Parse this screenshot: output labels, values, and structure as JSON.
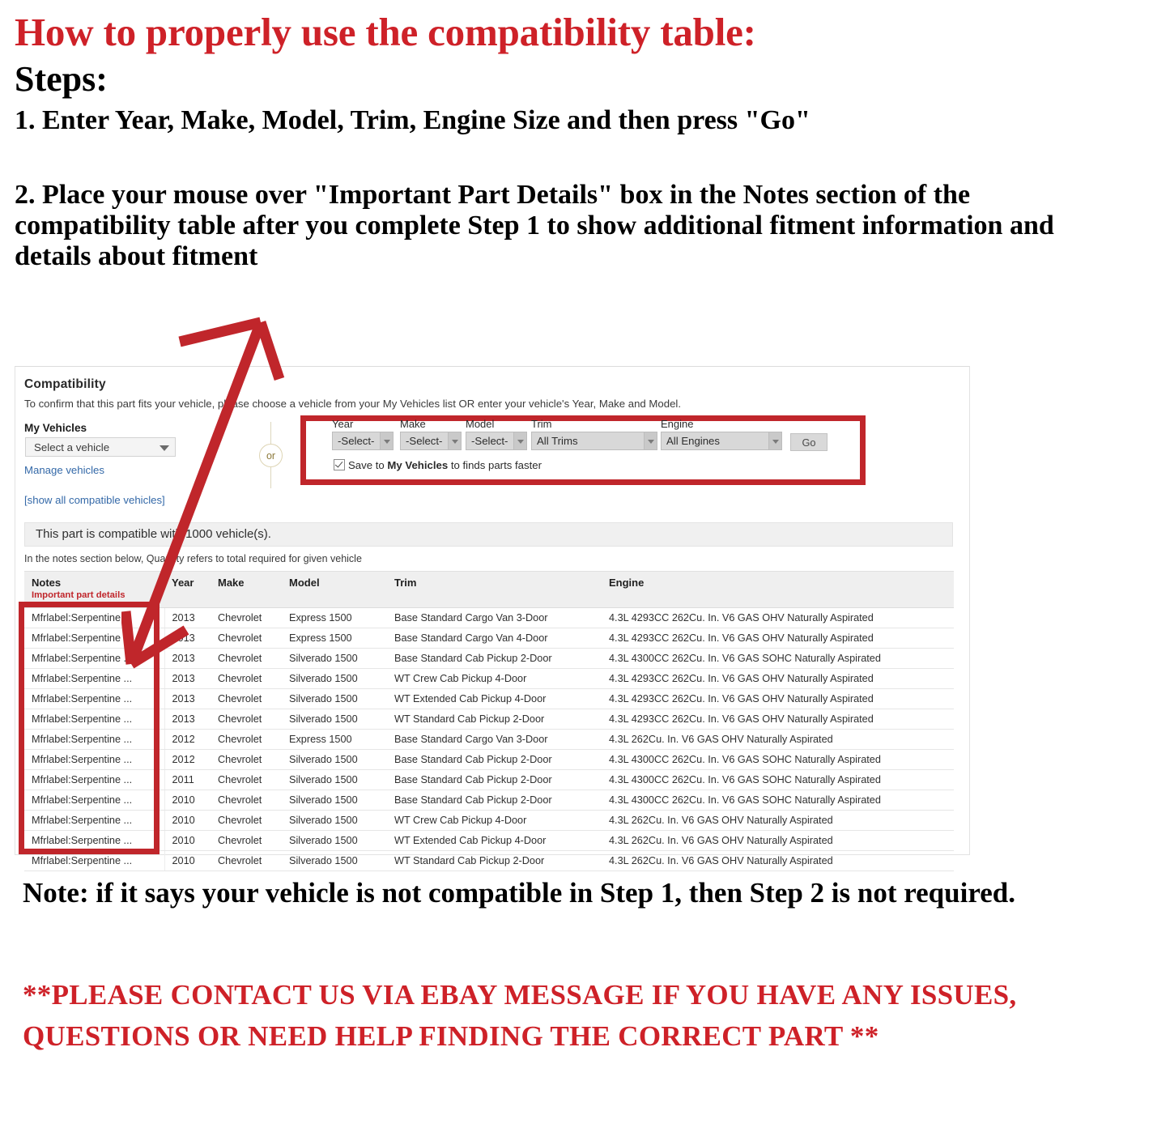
{
  "instructions": {
    "heading": "How to properly use the compatibility table:",
    "steps_label": "Steps:",
    "step1": "1. Enter Year, Make, Model, Trim, Engine Size and then press \"Go\"",
    "step2": "2. Place your mouse over \"Important Part Details\" box in the Notes section of the compatibility table after you complete Step 1 to show additional fitment information and details about fitment"
  },
  "colors": {
    "accent_red": "#CE2128",
    "box_red": "#C0262B",
    "link_blue": "#3469A8"
  },
  "panel": {
    "title": "Compatibility",
    "subtitle": "To confirm that this part fits your vehicle, please choose a vehicle from your My Vehicles list OR enter your vehicle's Year, Make and Model.",
    "my_vehicles_label": "My Vehicles",
    "vehicle_select_value": "Select a vehicle",
    "manage_vehicles_link": "Manage vehicles",
    "show_all_link": "[show all compatible vehicles]",
    "or_divider": "or",
    "fields": [
      {
        "label": "Year",
        "value": "-Select-"
      },
      {
        "label": "Make",
        "value": "-Select-"
      },
      {
        "label": "Model",
        "value": "-Select-"
      },
      {
        "label": "Trim",
        "value": "All Trims"
      },
      {
        "label": "Engine",
        "value": "All Engines"
      }
    ],
    "go_button": "Go",
    "save_checkbox": {
      "checked": true,
      "prefix": "Save to ",
      "bold": "My Vehicles",
      "suffix": " to finds parts faster"
    },
    "compatible_banner": "This part is compatible with 1000 vehicle(s).",
    "quantity_note": "In the notes section below, Quantity refers to total required for given vehicle",
    "table": {
      "headers": [
        "Notes",
        "Year",
        "Make",
        "Model",
        "Trim",
        "Engine"
      ],
      "notes_subheader": "Important part details",
      "rows": [
        {
          "notes": "Mfrlabel:Serpentine ...",
          "year": "2013",
          "make": "Chevrolet",
          "model": "Express 1500",
          "trim": "Base Standard Cargo Van 3-Door",
          "engine": "4.3L 4293CC 262Cu. In. V6 GAS OHV Naturally Aspirated"
        },
        {
          "notes": "Mfrlabel:Serpentine ...",
          "year": "2013",
          "make": "Chevrolet",
          "model": "Express 1500",
          "trim": "Base Standard Cargo Van 4-Door",
          "engine": "4.3L 4293CC 262Cu. In. V6 GAS OHV Naturally Aspirated"
        },
        {
          "notes": "Mfrlabel:Serpentine ...",
          "year": "2013",
          "make": "Chevrolet",
          "model": "Silverado 1500",
          "trim": "Base Standard Cab Pickup 2-Door",
          "engine": "4.3L 4300CC 262Cu. In. V6 GAS SOHC Naturally Aspirated"
        },
        {
          "notes": "Mfrlabel:Serpentine ...",
          "year": "2013",
          "make": "Chevrolet",
          "model": "Silverado 1500",
          "trim": "WT Crew Cab Pickup 4-Door",
          "engine": "4.3L 4293CC 262Cu. In. V6 GAS OHV Naturally Aspirated"
        },
        {
          "notes": "Mfrlabel:Serpentine ...",
          "year": "2013",
          "make": "Chevrolet",
          "model": "Silverado 1500",
          "trim": "WT Extended Cab Pickup 4-Door",
          "engine": "4.3L 4293CC 262Cu. In. V6 GAS OHV Naturally Aspirated"
        },
        {
          "notes": "Mfrlabel:Serpentine ...",
          "year": "2013",
          "make": "Chevrolet",
          "model": "Silverado 1500",
          "trim": "WT Standard Cab Pickup 2-Door",
          "engine": "4.3L 4293CC 262Cu. In. V6 GAS OHV Naturally Aspirated"
        },
        {
          "notes": "Mfrlabel:Serpentine ...",
          "year": "2012",
          "make": "Chevrolet",
          "model": "Express 1500",
          "trim": "Base Standard Cargo Van 3-Door",
          "engine": "4.3L 262Cu. In. V6 GAS OHV Naturally Aspirated"
        },
        {
          "notes": "Mfrlabel:Serpentine ...",
          "year": "2012",
          "make": "Chevrolet",
          "model": "Silverado 1500",
          "trim": "Base Standard Cab Pickup 2-Door",
          "engine": "4.3L 4300CC 262Cu. In. V6 GAS SOHC Naturally Aspirated"
        },
        {
          "notes": "Mfrlabel:Serpentine ...",
          "year": "2011",
          "make": "Chevrolet",
          "model": "Silverado 1500",
          "trim": "Base Standard Cab Pickup 2-Door",
          "engine": "4.3L 4300CC 262Cu. In. V6 GAS SOHC Naturally Aspirated"
        },
        {
          "notes": "Mfrlabel:Serpentine ...",
          "year": "2010",
          "make": "Chevrolet",
          "model": "Silverado 1500",
          "trim": "Base Standard Cab Pickup 2-Door",
          "engine": "4.3L 4300CC 262Cu. In. V6 GAS SOHC Naturally Aspirated"
        },
        {
          "notes": "Mfrlabel:Serpentine ...",
          "year": "2010",
          "make": "Chevrolet",
          "model": "Silverado 1500",
          "trim": "WT Crew Cab Pickup 4-Door",
          "engine": "4.3L 262Cu. In. V6 GAS OHV Naturally Aspirated"
        },
        {
          "notes": "Mfrlabel:Serpentine ...",
          "year": "2010",
          "make": "Chevrolet",
          "model": "Silverado 1500",
          "trim": "WT Extended Cab Pickup 4-Door",
          "engine": "4.3L 262Cu. In. V6 GAS OHV Naturally Aspirated"
        },
        {
          "notes": "Mfrlabel:Serpentine ...",
          "year": "2010",
          "make": "Chevrolet",
          "model": "Silverado 1500",
          "trim": "WT Standard Cab Pickup 2-Door",
          "engine": "4.3L 262Cu. In. V6 GAS OHV Naturally Aspirated"
        }
      ]
    }
  },
  "footer": {
    "note": "Note: if it says your vehicle is not compatible in Step 1, then Step 2 is not required.",
    "contact": "**PLEASE CONTACT US VIA EBAY MESSAGE IF YOU HAVE ANY ISSUES, QUESTIONS OR NEED HELP FINDING THE CORRECT PART **"
  }
}
